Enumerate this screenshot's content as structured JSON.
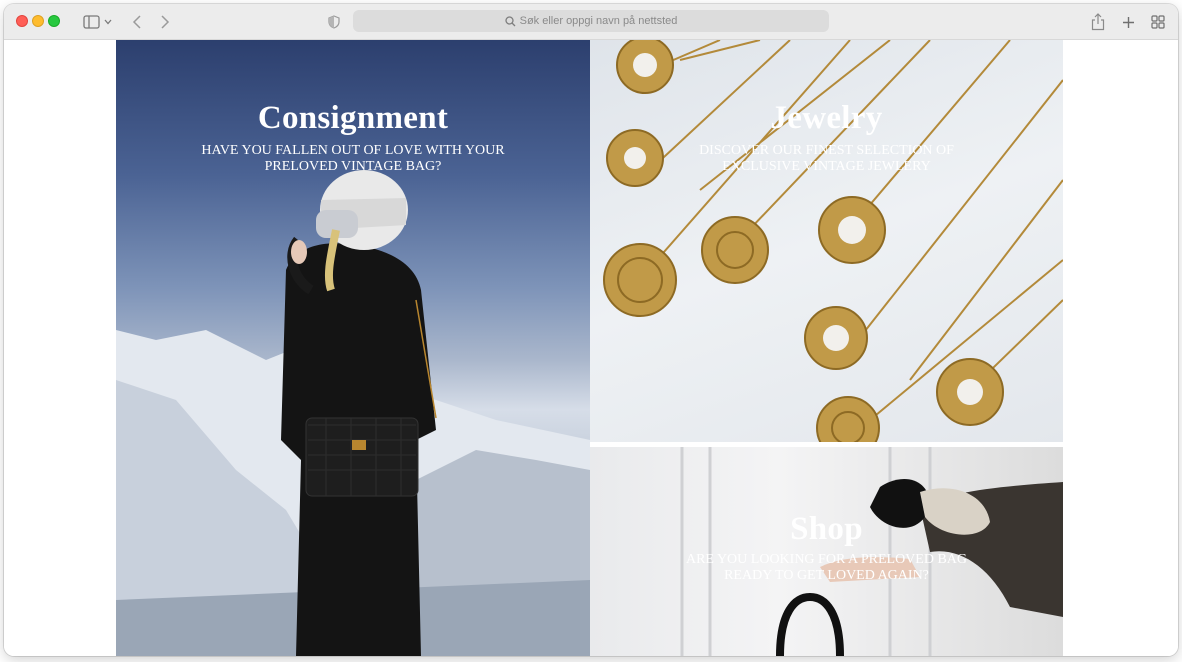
{
  "browser": {
    "address_placeholder": "Søk eller oppgi navn på nettsted",
    "icons": [
      "sidebar-icon",
      "back-icon",
      "forward-icon",
      "shield-icon",
      "search-icon",
      "share-icon",
      "plus-icon",
      "tabs-icon"
    ]
  },
  "tiles": [
    {
      "title": "Consignment",
      "subtitle": "HAVE YOU FALLEN OUT OF LOVE WITH YOUR PRELOVED VINTAGE BAG?"
    },
    {
      "title": "Jewelry",
      "subtitle": "DISCOVER OUR FINEST SELECTION OF EXCLUSIVE VINTAGE JEWLERY"
    },
    {
      "title": "Shop",
      "subtitle": "ARE YOU LOOKING FOR A PRELOVED BAG READY TO GET LOVED AGAIN?"
    }
  ],
  "colors": {
    "toolbar": "#ececec",
    "text_overlay": "#ffffff",
    "gold": "#b8862f"
  }
}
